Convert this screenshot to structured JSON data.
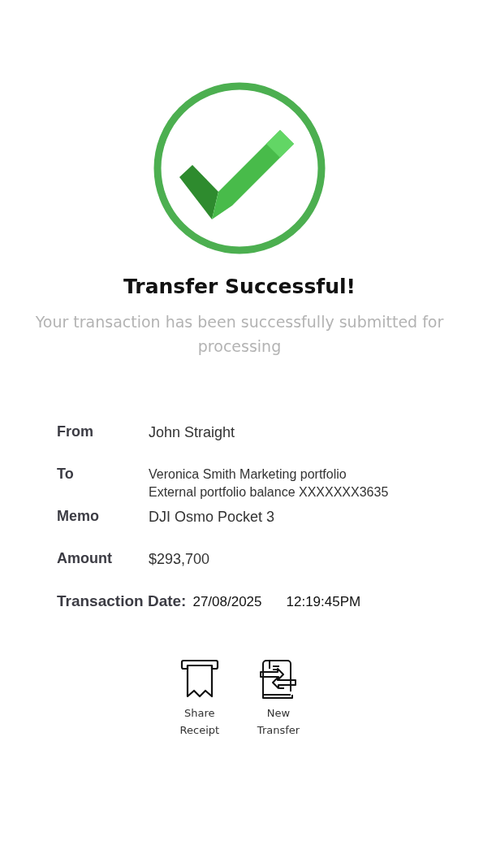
{
  "title": "Transfer Successful!",
  "subtitle": "Your transaction has been successfully submitted for processing",
  "details": [
    {
      "label": "From",
      "lines": [
        "John Straight"
      ]
    },
    {
      "label": "To",
      "lines": [
        "Veronica Smith Marketing portfolio",
        "External portfolio balance XXXXXXX3635"
      ]
    },
    {
      "label": "Memo",
      "lines": [
        "DJI Osmo Pocket 3"
      ]
    },
    {
      "label": "Amount",
      "lines": [
        "$293,700"
      ]
    }
  ],
  "transaction_date": {
    "label": "Transaction Date:",
    "date": "27/08/2025",
    "time": "12:19:45PM"
  },
  "actions": [
    {
      "kind": "receipt",
      "label_lines": [
        "Share",
        "Receipt"
      ]
    },
    {
      "kind": "transfer",
      "label_lines": [
        "New",
        "Transfer"
      ]
    }
  ]
}
